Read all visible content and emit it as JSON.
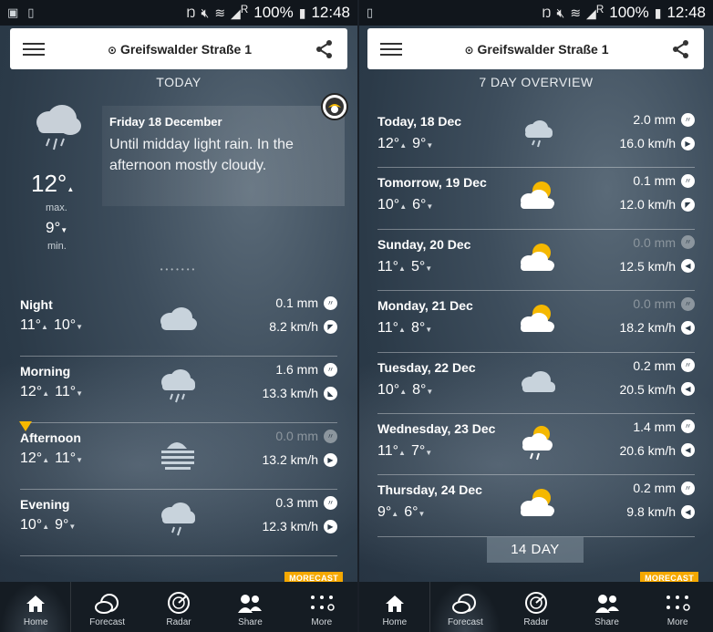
{
  "status": {
    "battery": "100%",
    "time": "12:48",
    "network_label": "R"
  },
  "location": "Greifswalder Straße 1",
  "today_panel": {
    "section_title": "TODAY",
    "date": "Friday 18 December",
    "description": "Until midday light rain. In the afternoon mostly cloudy.",
    "max_temp": "12°",
    "max_label": "max.",
    "min_temp": "9°",
    "min_label": "min.",
    "page_dots": "•••••••",
    "periods": [
      {
        "name": "Night",
        "tmax": "11°",
        "tmin": "10°",
        "icon": "cloud-icon",
        "rain": "0.1 mm",
        "rain_dim": false,
        "wind": "8.2 km/h"
      },
      {
        "name": "Morning",
        "tmax": "12°",
        "tmin": "11°",
        "icon": "rain-cloud-icon",
        "rain": "1.6 mm",
        "rain_dim": false,
        "wind": "13.3 km/h"
      },
      {
        "name": "Afternoon",
        "tmax": "12°",
        "tmin": "11°",
        "icon": "fog-icon",
        "rain": "0.0 mm",
        "rain_dim": true,
        "wind": "13.2 km/h"
      },
      {
        "name": "Evening",
        "tmax": "10°",
        "tmin": "9°",
        "icon": "rain-cloud-icon",
        "rain": "0.3 mm",
        "rain_dim": false,
        "wind": "12.3 km/h"
      }
    ]
  },
  "week_panel": {
    "section_title": "7 DAY OVERVIEW",
    "days": [
      {
        "name": "Today, 18 Dec",
        "tmax": "12°",
        "tmin": "9°",
        "icon": "rain-cloud-icon",
        "rain": "2.0 mm",
        "rain_dim": false,
        "wind": "16.0 km/h"
      },
      {
        "name": "Tomorrow, 19 Dec",
        "tmax": "10°",
        "tmin": "6°",
        "icon": "sun-cloud-icon",
        "rain": "0.1 mm",
        "rain_dim": false,
        "wind": "12.0 km/h"
      },
      {
        "name": "Sunday, 20 Dec",
        "tmax": "11°",
        "tmin": "5°",
        "icon": "sun-cloud-icon",
        "rain": "0.0 mm",
        "rain_dim": true,
        "wind": "12.5 km/h"
      },
      {
        "name": "Monday, 21 Dec",
        "tmax": "11°",
        "tmin": "8°",
        "icon": "sun-cloud-icon",
        "rain": "0.0 mm",
        "rain_dim": true,
        "wind": "18.2 km/h"
      },
      {
        "name": "Tuesday, 22 Dec",
        "tmax": "10°",
        "tmin": "8°",
        "icon": "cloud-icon",
        "rain": "0.2 mm",
        "rain_dim": false,
        "wind": "20.5 km/h"
      },
      {
        "name": "Wednesday, 23 Dec",
        "tmax": "11°",
        "tmin": "7°",
        "icon": "sun-rain-cloud-icon",
        "rain": "1.4 mm",
        "rain_dim": false,
        "wind": "20.6 km/h"
      },
      {
        "name": "Thursday, 24 Dec",
        "tmax": "9°",
        "tmin": "6°",
        "icon": "sun-cloud-icon",
        "rain": "0.2 mm",
        "rain_dim": false,
        "wind": "9.8 km/h"
      }
    ],
    "more_button": "14 DAY"
  },
  "brand": "MORECAST",
  "nav": {
    "home": "Home",
    "forecast": "Forecast",
    "radar": "Radar",
    "share": "Share",
    "more": "More"
  },
  "colors": {
    "accent": "#f5a800",
    "marker": "#f5b800"
  }
}
